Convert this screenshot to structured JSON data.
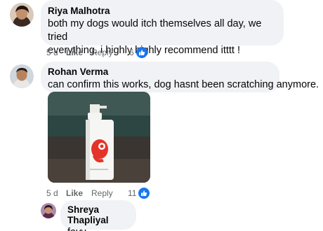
{
  "comments": [
    {
      "author": "Riya Malhotra",
      "text_line1": "both my dogs would itch themselves all day, we tried",
      "text_line2": "everything. i highly highly recommend itttt !",
      "time": "5 d",
      "like_label": "Like",
      "reply_label": "Reply",
      "reaction_count": "6"
    },
    {
      "author": "Rohan Verma",
      "text": "can confirm this works, dog hasnt been scratching anymore.",
      "time": "5 d",
      "like_label": "Like",
      "reply_label": "Reply",
      "reaction_count": "11"
    },
    {
      "author": "Shreya Thapliyal",
      "text": "favv"
    }
  ],
  "icons": {
    "reaction": "thumbs-up-icon",
    "avatar": "profile-photo"
  },
  "colors": {
    "bubble": "#f0f2f5",
    "meta_text": "#65676b",
    "reaction_blue": "#1877f2"
  }
}
